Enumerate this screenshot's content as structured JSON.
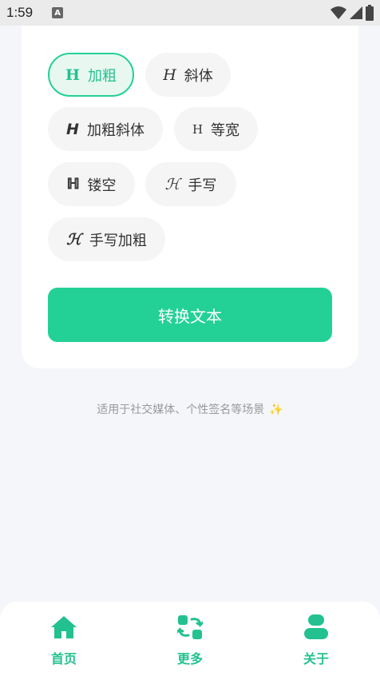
{
  "status_bar": {
    "time": "1:59",
    "notification_icon": "A"
  },
  "styles": [
    {
      "glyph": "H",
      "label": "加粗",
      "selected": true
    },
    {
      "glyph": "H",
      "label": "斜体",
      "selected": false
    },
    {
      "glyph": "H",
      "label": "加粗斜体",
      "selected": false
    },
    {
      "glyph": "H",
      "label": "等宽",
      "selected": false
    },
    {
      "glyph": "ℍ",
      "label": "镂空",
      "selected": false
    },
    {
      "glyph": "ℋ",
      "label": "手写",
      "selected": false
    },
    {
      "glyph": "ℋ",
      "label": "手写加粗",
      "selected": false
    }
  ],
  "convert_button": "转换文本",
  "hint": {
    "text": "适用于社交媒体、个性签名等场景",
    "emoji": "✨"
  },
  "nav": [
    {
      "label": "首页",
      "icon": "home-icon"
    },
    {
      "label": "更多",
      "icon": "switch-icon"
    },
    {
      "label": "关于",
      "icon": "user-icon"
    }
  ],
  "colors": {
    "accent": "#23d196",
    "background": "#f5f6fa",
    "chip_bg": "#f5f5f5"
  }
}
